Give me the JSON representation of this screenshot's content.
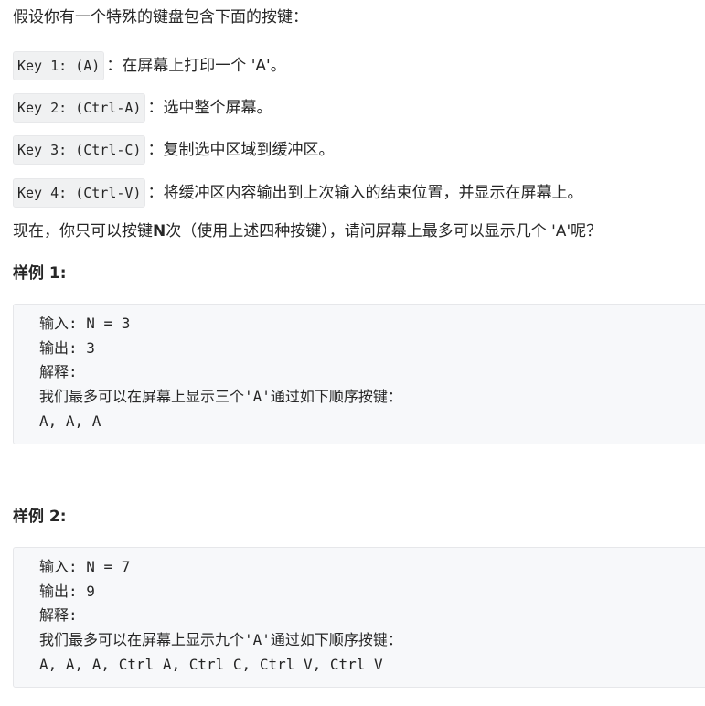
{
  "intro": "假设你有一个特殊的键盘包含下面的按键：",
  "keys": [
    {
      "code": "Key 1: (A)",
      "desc": "：在屏幕上打印一个 'A'。"
    },
    {
      "code": "Key 2: (Ctrl-A)",
      "desc": "：选中整个屏幕。"
    },
    {
      "code": "Key 3: (Ctrl-C)",
      "desc": "：复制选中区域到缓冲区。"
    },
    {
      "code": "Key 4: (Ctrl-V)",
      "desc": "：将缓冲区内容输出到上次输入的结束位置，并显示在屏幕上。"
    }
  ],
  "question": {
    "prefix": "现在，你只可以按键 ",
    "bold": "N",
    "suffix": " 次（使用上述四种按键），请问屏幕上最多可以显示几个 'A'呢？"
  },
  "examples": [
    {
      "title": "样例 1:",
      "lines": [
        "输入: N = 3",
        "输出: 3",
        "解释:",
        "我们最多可以在屏幕上显示三个'A'通过如下顺序按键：",
        "A, A, A"
      ]
    },
    {
      "title": "样例 2:",
      "lines": [
        "输入: N = 7",
        "输出: 9",
        "解释:",
        "我们最多可以在屏幕上显示九个'A'通过如下顺序按键：",
        "A, A, A, Ctrl A, Ctrl C, Ctrl V, Ctrl V"
      ]
    }
  ]
}
